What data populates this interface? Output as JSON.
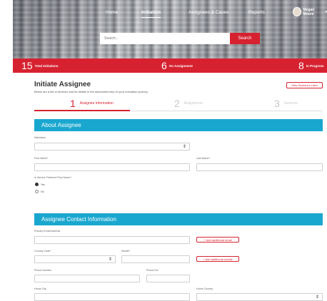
{
  "nav": {
    "items": [
      {
        "label": "Home",
        "active": false
      },
      {
        "label": "Initiation",
        "active": true
      },
      {
        "label": "Assignees & Cases",
        "active": false
      },
      {
        "label": "Reports",
        "active": false
      }
    ],
    "user_name": "Megan Moore"
  },
  "search": {
    "placeholder": "Search...",
    "button_label": "Search"
  },
  "stats": [
    {
      "value": "15",
      "label": "Total Initiations"
    },
    {
      "value": "6",
      "label": "On Assignment"
    },
    {
      "value": "8",
      "label": "In Progress"
    }
  ],
  "page": {
    "title": "Initiate Assignee",
    "subtitle": "Below are a list of services and its details in the associated step of your relocation journey.",
    "save_label": "View Saved for Later"
  },
  "steps": [
    {
      "number": "1",
      "label": "Assignee Information",
      "active": true
    },
    {
      "number": "2",
      "label": "Assignment",
      "active": false
    },
    {
      "number": "3",
      "label": "Services",
      "active": false
    }
  ],
  "about": {
    "heading": "About Assignee",
    "salutation_label": "Salutation",
    "first_name_label": "First Name*",
    "last_name_label": "Last Name*",
    "preferred_question": "Is this the Preferred First Name?",
    "yes_label": "Yes",
    "no_label": "No"
  },
  "contact": {
    "heading": "Assignee Contact Information",
    "email_label": "Primary Email Address",
    "add_email_label": "+ Add additional email",
    "country_code_label": "Country Code*",
    "mobile_label": "Mobile*",
    "add_mobile_label": "+ Add additional mobile",
    "phone_label": "Phone Number",
    "phone_ext_label": "Phone Ext",
    "home_city_label": "Home City",
    "home_country_label": "Home Country"
  },
  "colors": {
    "brand_red": "#d62230",
    "section_blue": "#1aa7cf"
  }
}
